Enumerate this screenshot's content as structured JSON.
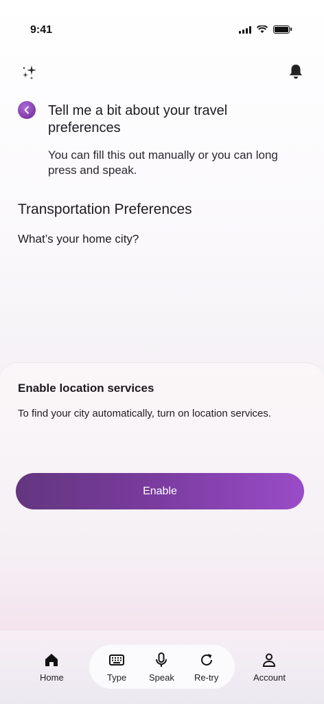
{
  "status": {
    "time": "9:41"
  },
  "header": {
    "heading": "Tell me a bit about your travel preferences",
    "subheading": "You can fill this out manually or you can long press and speak."
  },
  "section": {
    "title": "Transportation Preferences",
    "question": "What’s your home city?"
  },
  "sheet": {
    "title": "Enable location services",
    "body": "To find your city automatically, turn on location services.",
    "button_label": "Enable"
  },
  "nav": {
    "home": "Home",
    "type": "Type",
    "speak": "Speak",
    "retry": "Re-try",
    "account": "Account"
  },
  "colors": {
    "accent": "#7b3ca0",
    "accent_light": "#9a4cc8"
  }
}
